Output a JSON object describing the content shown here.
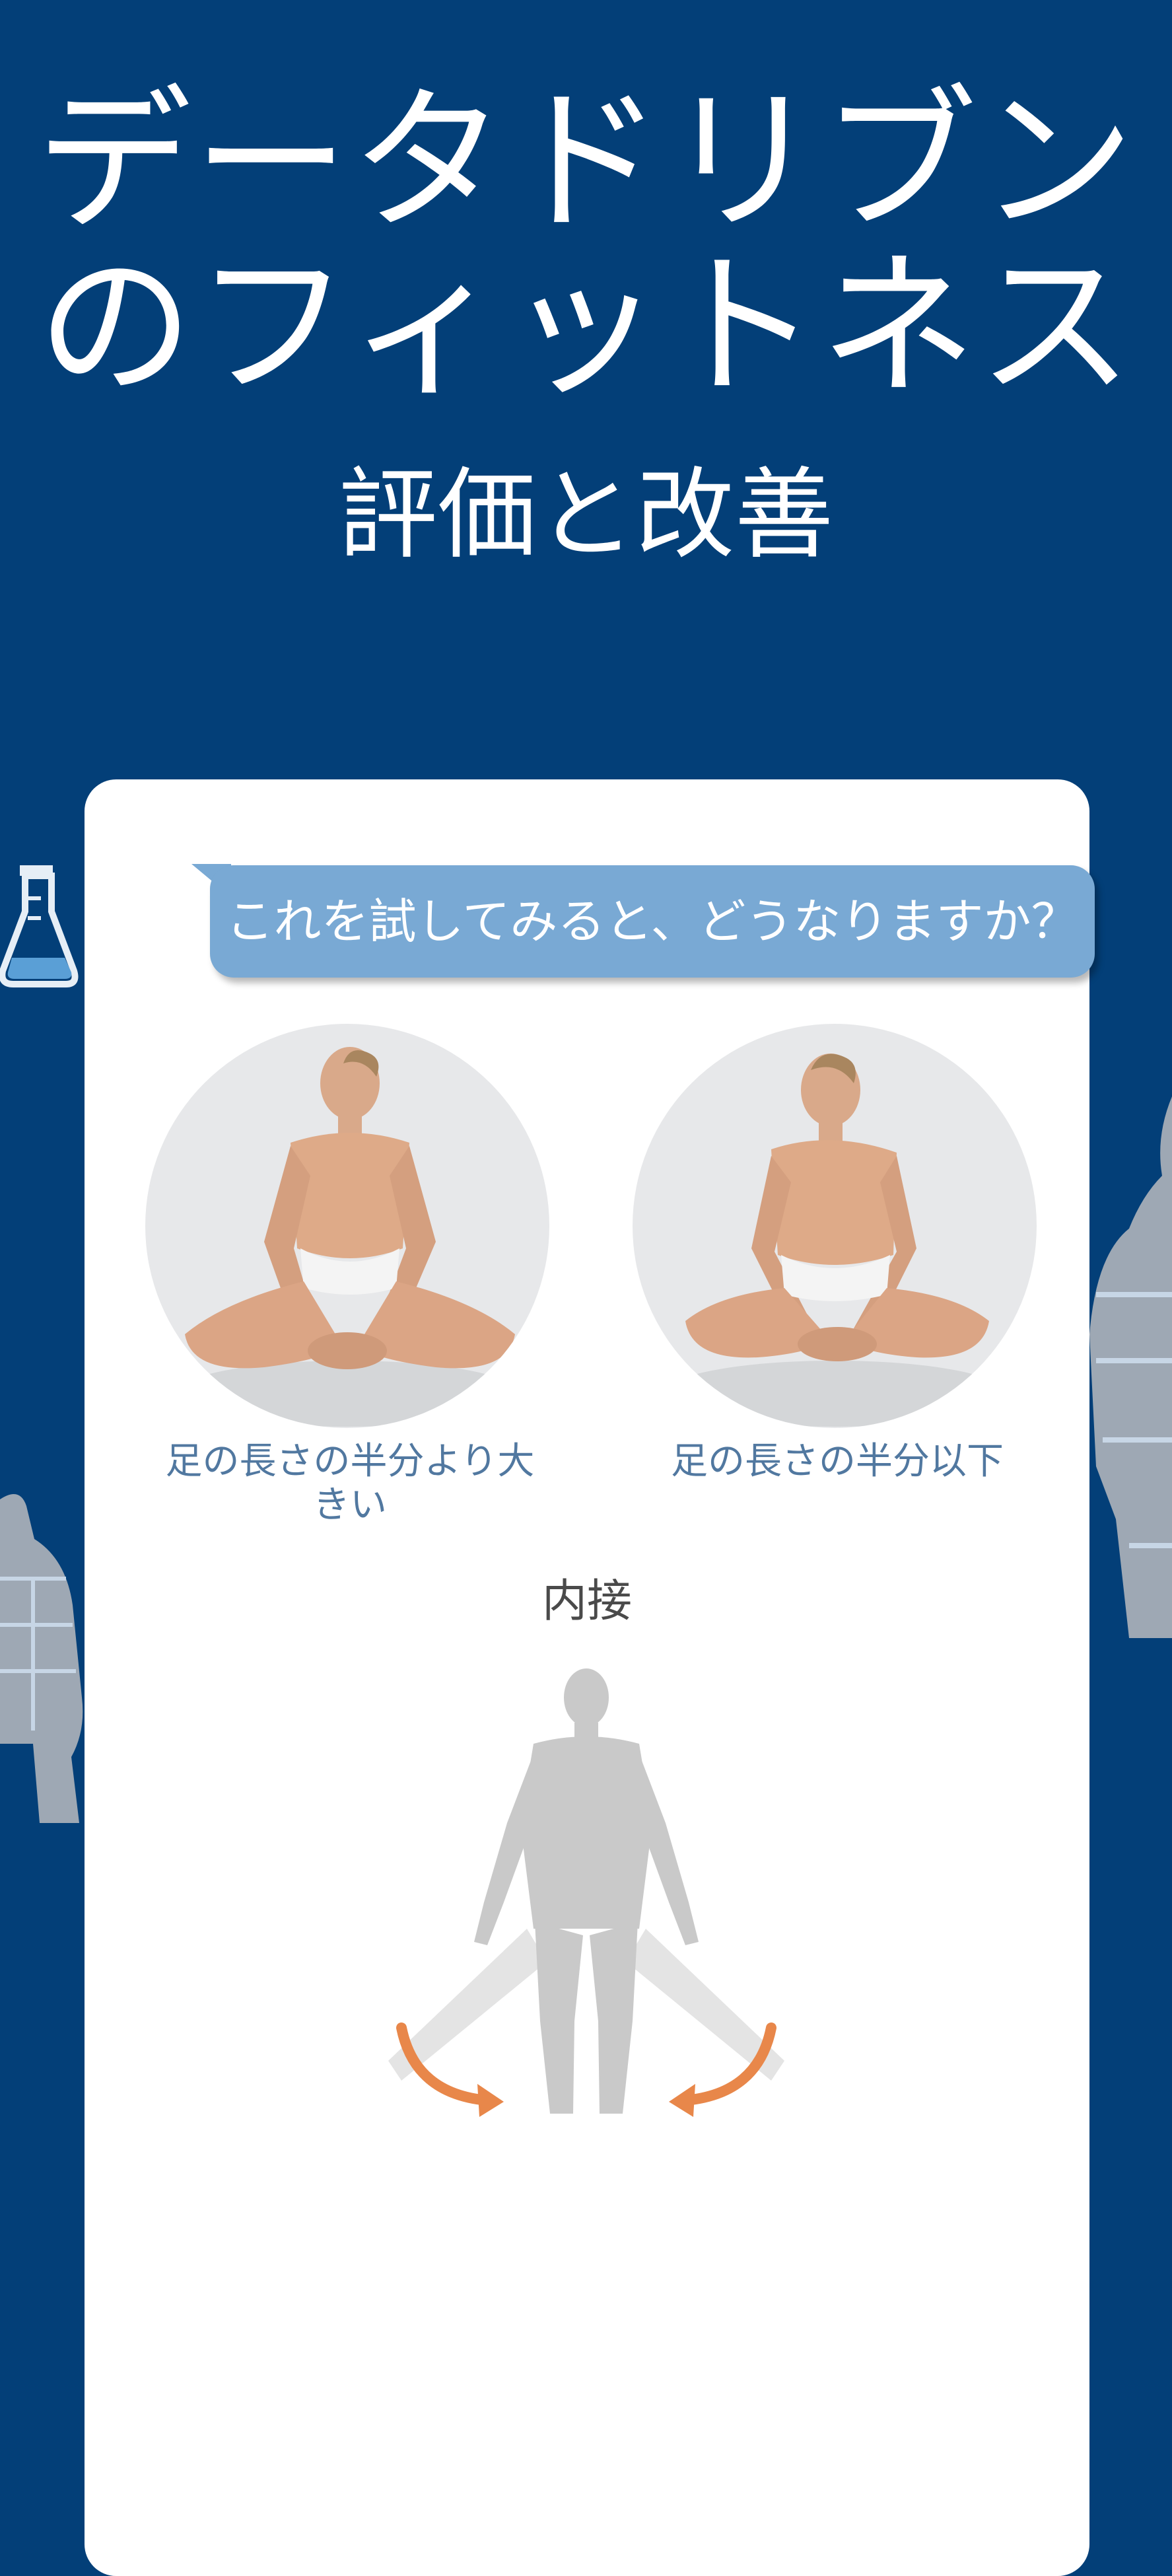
{
  "headline": {
    "line1": "データドリブン",
    "line2": "のフィットネス"
  },
  "subheadline": "評価と改善",
  "card": {
    "question": "これを試してみると、どうなりますか？",
    "options": [
      {
        "label_line1": "足の長さの半分より大",
        "label_line2": "きい"
      },
      {
        "label_line1": "足の長さの半分以下",
        "label_line2": ""
      }
    ],
    "section_title": "内接"
  },
  "colors": {
    "background": "#033f78",
    "bubble": "#79a9d4",
    "label": "#5178a0",
    "arrow": "#e8874a",
    "figure": "#c9c9c9"
  },
  "icons": {
    "flask": "flask-icon",
    "arrows": "adduction-arrow-icon"
  }
}
